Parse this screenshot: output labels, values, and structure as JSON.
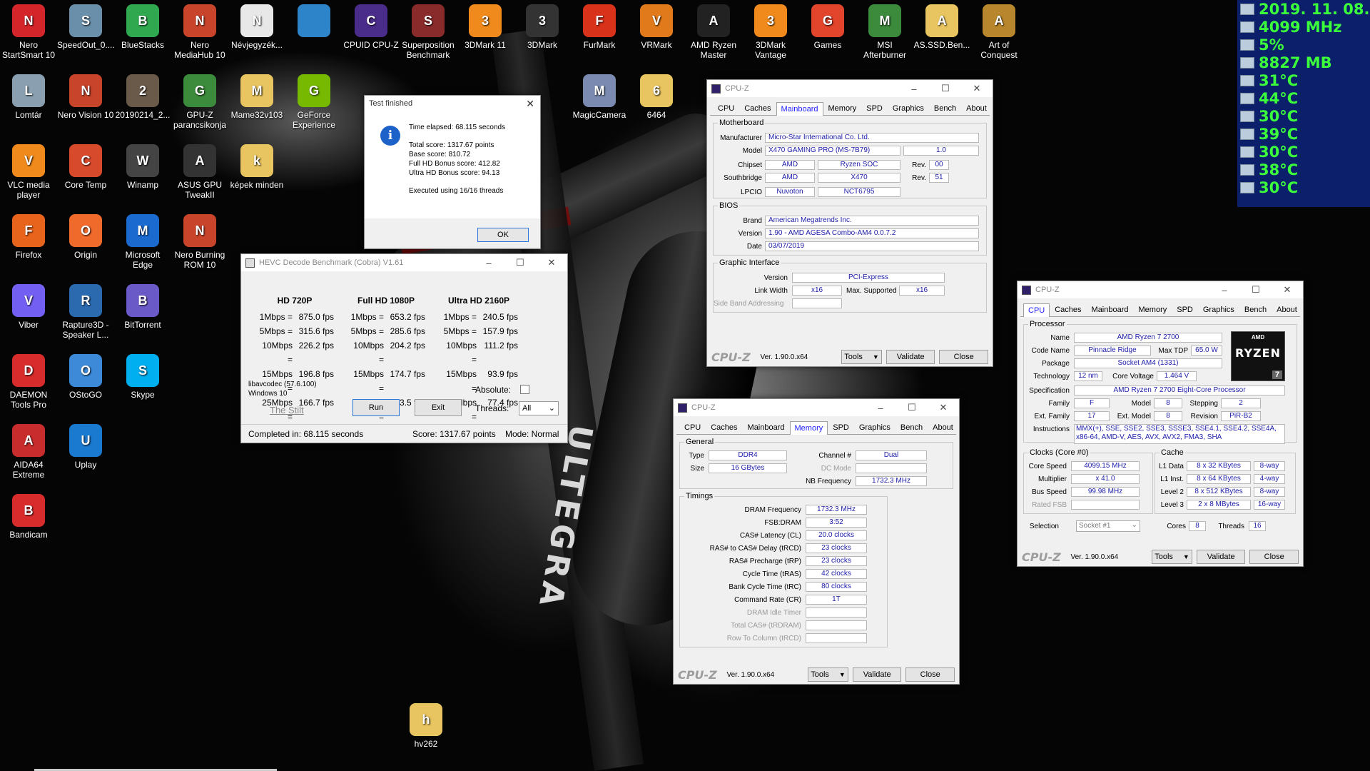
{
  "desktop_icons": [
    {
      "label": "Nero StartSmart 10",
      "icon": "nero-icon",
      "color": "#d4262a"
    },
    {
      "label": "SpeedOut_0....",
      "icon": "speedometer-icon",
      "color": "#6a8faa"
    },
    {
      "label": "BlueStacks",
      "icon": "bluestacks-icon",
      "color": "#2fa84f"
    },
    {
      "label": "Nero MediaHub 10",
      "icon": "nero-mediahub-icon",
      "color": "#c8452c"
    },
    {
      "label": "Névjegyzék...",
      "icon": "contacts-icon",
      "color": "#e8e8e8"
    },
    {
      "label": "",
      "icon": "id-card-icon",
      "color": "#2e84c9"
    },
    {
      "label": "CPUID CPU-Z",
      "icon": "cpu-z-icon",
      "color": "#4a2c8a"
    },
    {
      "label": "Superposition Benchmark",
      "icon": "superposition-icon",
      "color": "#8a2b2b"
    },
    {
      "label": "3DMark 11",
      "icon": "3dmark11-icon",
      "color": "#f08a1c"
    },
    {
      "label": "3DMark",
      "icon": "3dmark-icon",
      "color": "#333333"
    },
    {
      "label": "FurMark",
      "icon": "furmark-icon",
      "color": "#d8321a"
    },
    {
      "label": "VRMark",
      "icon": "vrmark-icon",
      "color": "#e07a1a"
    },
    {
      "label": "AMD Ryzen Master",
      "icon": "ryzen-master-icon",
      "color": "#222222"
    },
    {
      "label": "3DMark Vantage",
      "icon": "3dmark-vantage-icon",
      "color": "#f08a1c"
    },
    {
      "label": "Games",
      "icon": "games-icon",
      "color": "#e2442c"
    },
    {
      "label": "MSI Afterburner",
      "icon": "afterburner-icon",
      "color": "#3c8a3c"
    },
    {
      "label": "AS.SSD.Ben...",
      "icon": "folder-icon",
      "color": "#e8c560"
    },
    {
      "label": "Art of Conquest",
      "icon": "art-of-conquest-icon",
      "color": "#b8862c"
    },
    {
      "label": "Lomtár",
      "icon": "recycle-bin-icon",
      "color": "#8aa0b0"
    },
    {
      "label": "Nero Vision 10",
      "icon": "nero-vision-icon",
      "color": "#c8452c"
    },
    {
      "label": "20190214_2...",
      "icon": "image-file-icon",
      "color": "#6a5a4a"
    },
    {
      "label": "GPU-Z parancsikonja",
      "icon": "gpu-z-icon",
      "color": "#3c8a3c"
    },
    {
      "label": "Mame32v103",
      "icon": "folder-icon",
      "color": "#e8c560"
    },
    {
      "label": "GeForce Experience",
      "icon": "geforce-icon",
      "color": "#76b900"
    },
    {
      "label": "MagicCamera",
      "icon": "magic-camera-icon",
      "color": "#7a8ab0"
    },
    {
      "label": "6464",
      "icon": "folder-icon",
      "color": "#e8c560"
    },
    {
      "label": "VLC media player",
      "icon": "vlc-icon",
      "color": "#f08a1c"
    },
    {
      "label": "Core Temp",
      "icon": "thermometer-icon",
      "color": "#d84a2c"
    },
    {
      "label": "Winamp",
      "icon": "winamp-icon",
      "color": "#444444"
    },
    {
      "label": "ASUS GPU TweakII",
      "icon": "asus-gpu-tweak-icon",
      "color": "#333333"
    },
    {
      "label": "képek minden",
      "icon": "folder-icon",
      "color": "#e8c560"
    },
    {
      "label": "Firefox",
      "icon": "firefox-icon",
      "color": "#e8641c"
    },
    {
      "label": "Origin",
      "icon": "origin-icon",
      "color": "#f06a2c"
    },
    {
      "label": "Microsoft Edge",
      "icon": "edge-icon",
      "color": "#1a6ad0"
    },
    {
      "label": "Nero Burning ROM 10",
      "icon": "nero-burning-icon",
      "color": "#c8452c"
    },
    {
      "label": "Viber",
      "icon": "viber-icon",
      "color": "#7360f2"
    },
    {
      "label": "Rapture3D - Speaker L...",
      "icon": "rapture3d-icon",
      "color": "#2c6ab0"
    },
    {
      "label": "BitTorrent",
      "icon": "bittorrent-icon",
      "color": "#6a5ac8"
    },
    {
      "label": "DAEMON Tools Pro",
      "icon": "daemon-tools-icon",
      "color": "#d82c2c"
    },
    {
      "label": "OStoGO",
      "icon": "ostogo-icon",
      "color": "#3c8ad8"
    },
    {
      "label": "Skype",
      "icon": "skype-icon",
      "color": "#00aff0"
    },
    {
      "label": "AIDA64 Extreme",
      "icon": "aida64-icon",
      "color": "#c82c2c"
    },
    {
      "label": "Uplay",
      "icon": "uplay-icon",
      "color": "#1a7ad0"
    },
    {
      "label": "Bandicam",
      "icon": "bandicam-icon",
      "color": "#d82c2c"
    },
    {
      "label": "hv262",
      "icon": "folder-icon",
      "color": "#e8c560"
    }
  ],
  "osd": [
    "2019. 11. 08.",
    "4099 MHz",
    "5%",
    "8827 MB",
    "31°C",
    "44°C",
    "30°C",
    "39°C",
    "30°C",
    "38°C",
    "30°C"
  ],
  "test_dialog": {
    "title": "Test finished",
    "elapsed": "Time elapsed:  68.115 seconds",
    "total": "Total score:  1317.67 points",
    "base": "Base score: 810.72",
    "fullhd": "Full HD Bonus score: 412.82",
    "ultrahd": "Ultra HD Bonus score: 94.13",
    "threads": "Executed using 16/16 threads",
    "ok": "OK"
  },
  "hevc": {
    "title": "HEVC Decode Benchmark (Cobra) V1.61",
    "columns": [
      {
        "header": "HD 720P",
        "rows": [
          [
            "1Mbps =",
            "875.0 fps"
          ],
          [
            "5Mbps =",
            "315.6 fps"
          ],
          [
            "10Mbps =",
            "226.2 fps"
          ],
          [
            "15Mbps =",
            "196.8 fps"
          ],
          [
            "25Mbps =",
            "166.7 fps"
          ]
        ]
      },
      {
        "header": "Full HD 1080P",
        "rows": [
          [
            "1Mbps =",
            "653.2 fps"
          ],
          [
            "5Mbps =",
            "285.6 fps"
          ],
          [
            "10Mbps =",
            "204.2 fps"
          ],
          [
            "15Mbps =",
            "174.7 fps"
          ],
          [
            "25Mbps =",
            "143.5 fps"
          ]
        ]
      },
      {
        "header": "Ultra HD 2160P",
        "rows": [
          [
            "1Mbps =",
            "240.5 fps"
          ],
          [
            "5Mbps =",
            "157.9 fps"
          ],
          [
            "10Mbps =",
            "111.2 fps"
          ],
          [
            "15Mbps =",
            "93.9 fps"
          ],
          [
            "25Mbps =",
            "77.4 fps"
          ]
        ]
      }
    ],
    "libav": "libavcodec (57.6.100)",
    "os": "Windows 10",
    "credit": "The Stilt",
    "run": "Run",
    "exit": "Exit",
    "absolute_label": "Absolute:",
    "threads_label": "Threads:",
    "threads_value": "All",
    "status_completed": "Completed in: 68.115 seconds",
    "status_score": "Score: 1317.67 points",
    "status_mode": "Mode: Normal"
  },
  "cpuz_common": {
    "title": "CPU-Z",
    "tabs": [
      "CPU",
      "Caches",
      "Mainboard",
      "Memory",
      "SPD",
      "Graphics",
      "Bench",
      "About"
    ],
    "logo": "CPU-Z",
    "version": "Ver. 1.90.0.x64",
    "tools": "Tools",
    "validate": "Validate",
    "close": "Close"
  },
  "mainboard": {
    "motherboard_legend": "Motherboard",
    "manufacturer_label": "Manufacturer",
    "manufacturer": "Micro-Star International Co. Ltd.",
    "model_label": "Model",
    "model": "X470 GAMING PRO (MS-7B79)",
    "model_rev": "1.0",
    "chipset_label": "Chipset",
    "chipset_vendor": "AMD",
    "chipset": "Ryzen SOC",
    "rev_label": "Rev.",
    "chipset_rev": "00",
    "southbridge_label": "Southbridge",
    "southbridge_vendor": "AMD",
    "southbridge": "X470",
    "southbridge_rev": "51",
    "lpcio_label": "LPCIO",
    "lpcio_vendor": "Nuvoton",
    "lpcio": "NCT6795",
    "bios_legend": "BIOS",
    "brand_label": "Brand",
    "brand": "American Megatrends Inc.",
    "version_label": "Version",
    "version": "1.90 - AMD AGESA Combo-AM4 0.0.7.2",
    "date_label": "Date",
    "date": "03/07/2019",
    "gi_legend": "Graphic Interface",
    "gi_version_label": "Version",
    "gi_version": "PCI-Express",
    "link_width_label": "Link Width",
    "link_width": "x16",
    "max_supported_label": "Max. Supported",
    "max_supported": "x16",
    "side_band_label": "Side Band Addressing"
  },
  "memory": {
    "general_legend": "General",
    "type_label": "Type",
    "type": "DDR4",
    "channel_label": "Channel #",
    "channel": "Dual",
    "size_label": "Size",
    "size": "16 GBytes",
    "dc_mode_label": "DC Mode",
    "nb_freq_label": "NB Frequency",
    "nb_freq": "1732.3 MHz",
    "timings_legend": "Timings",
    "timings": [
      {
        "label": "DRAM Frequency",
        "value": "1732.3 MHz",
        "dim": false
      },
      {
        "label": "FSB:DRAM",
        "value": "3:52",
        "dim": false
      },
      {
        "label": "CAS# Latency (CL)",
        "value": "20.0 clocks",
        "dim": false
      },
      {
        "label": "RAS# to CAS# Delay (tRCD)",
        "value": "23 clocks",
        "dim": false
      },
      {
        "label": "RAS# Precharge (tRP)",
        "value": "23 clocks",
        "dim": false
      },
      {
        "label": "Cycle Time (tRAS)",
        "value": "42 clocks",
        "dim": false
      },
      {
        "label": "Bank Cycle Time (tRC)",
        "value": "80 clocks",
        "dim": false
      },
      {
        "label": "Command Rate (CR)",
        "value": "1T",
        "dim": false
      },
      {
        "label": "DRAM Idle Timer",
        "value": "",
        "dim": true
      },
      {
        "label": "Total CAS# (tRDRAM)",
        "value": "",
        "dim": true
      },
      {
        "label": "Row To Column (tRCD)",
        "value": "",
        "dim": true
      }
    ]
  },
  "cpu": {
    "processor_legend": "Processor",
    "name_label": "Name",
    "name": "AMD Ryzen 7 2700",
    "codename_label": "Code Name",
    "codename": "Pinnacle Ridge",
    "maxtdp_label": "Max TDP",
    "maxtdp": "65.0 W",
    "package_label": "Package",
    "package": "Socket AM4 (1331)",
    "technology_label": "Technology",
    "technology": "12 nm",
    "core_voltage_label": "Core Voltage",
    "core_voltage": "1.464 V",
    "spec_label": "Specification",
    "spec": "AMD Ryzen 7 2700 Eight-Core Processor",
    "family_label": "Family",
    "family": "F",
    "model_label": "Model",
    "model": "8",
    "stepping_label": "Stepping",
    "stepping": "2",
    "ext_family_label": "Ext. Family",
    "ext_family": "17",
    "ext_model_label": "Ext. Model",
    "ext_model": "8",
    "revision_label": "Revision",
    "revision": "PiR-B2",
    "instructions_label": "Instructions",
    "instructions": "MMX(+), SSE, SSE2, SSE3, SSSE3, SSE4.1, SSE4.2, SSE4A, x86-64, AMD-V, AES, AVX, AVX2, FMA3, SHA",
    "logo_brand": "AMD",
    "logo_name": "RYZEN",
    "logo_num": "7",
    "clocks_legend": "Clocks (Core #0)",
    "core_speed_label": "Core Speed",
    "core_speed": "4099.15 MHz",
    "multiplier_label": "Multiplier",
    "multiplier": "x 41.0",
    "bus_speed_label": "Bus Speed",
    "bus_speed": "99.98 MHz",
    "rated_fsb_label": "Rated FSB",
    "cache_legend": "Cache",
    "l1d_label": "L1 Data",
    "l1d": "8 x 32 KBytes",
    "l1d_way": "8-way",
    "l1i_label": "L1 Inst.",
    "l1i": "8 x 64 KBytes",
    "l1i_way": "4-way",
    "l2_label": "Level 2",
    "l2": "8 x 512 KBytes",
    "l2_way": "8-way",
    "l3_label": "Level 3",
    "l3": "2 x 8 MBytes",
    "l3_way": "16-way",
    "selection_label": "Selection",
    "selection": "Socket #1",
    "cores_label": "Cores",
    "cores": "8",
    "threads_label": "Threads",
    "threads": "16"
  }
}
